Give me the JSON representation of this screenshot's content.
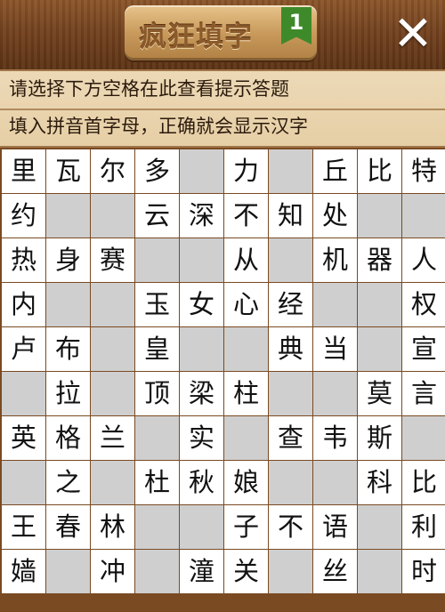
{
  "header": {
    "title": "疯狂填字",
    "level": "1",
    "close_icon": "close-x-icon"
  },
  "hints": {
    "line1": "请选择下方空格在此查看提示答题",
    "line2": "填入拼音首字母，正确就会显示汉字"
  },
  "colors": {
    "wood": "#6b3f1f",
    "hint_bg": "#ecd9b6",
    "cell_white": "#ffffff",
    "cell_gray": "#cfcfcf",
    "badge_green": "#3e8a2a"
  },
  "grid": [
    [
      "里",
      "瓦",
      "尔",
      "多",
      null,
      "力",
      null,
      "丘",
      "比",
      "特"
    ],
    [
      "约",
      null,
      null,
      "云",
      "深",
      "不",
      "知",
      "处",
      null,
      null
    ],
    [
      "热",
      "身",
      "赛",
      null,
      null,
      "从",
      null,
      "机",
      "器",
      "人"
    ],
    [
      "内",
      null,
      null,
      "玉",
      "女",
      "心",
      "经",
      null,
      null,
      "权"
    ],
    [
      "卢",
      "布",
      null,
      "皇",
      null,
      null,
      "典",
      "当",
      null,
      "宣"
    ],
    [
      null,
      "拉",
      null,
      "顶",
      "梁",
      "柱",
      null,
      null,
      "莫",
      "言"
    ],
    [
      "英",
      "格",
      "兰",
      null,
      "实",
      null,
      "查",
      "韦",
      "斯",
      null
    ],
    [
      null,
      "之",
      null,
      "杜",
      "秋",
      "娘",
      null,
      null,
      "科",
      "比"
    ],
    [
      "王",
      "春",
      "林",
      null,
      null,
      "子",
      "不",
      "语",
      null,
      "利"
    ],
    [
      "嫱",
      null,
      "冲",
      null,
      "潼",
      "关",
      null,
      "丝",
      null,
      "时"
    ]
  ]
}
